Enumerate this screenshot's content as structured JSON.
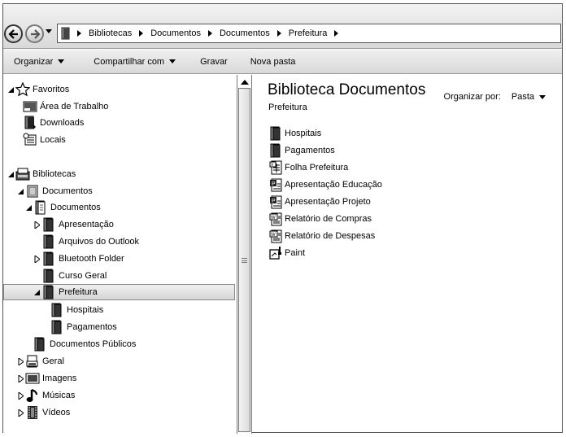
{
  "breadcrumb": [
    "Bibliotecas",
    "Documentos",
    "Documentos",
    "Prefeitura"
  ],
  "toolbar": {
    "organize": "Organizar",
    "share": "Compartilhar com",
    "burn": "Gravar",
    "new_folder": "Nova pasta"
  },
  "nav": {
    "favorites": "Favoritos",
    "desktop": "Área de Trabalho",
    "downloads": "Downloads",
    "places": "Locais",
    "libraries": "Bibliotecas",
    "documents_lib": "Documentos",
    "documents_folder": "Documentos",
    "presentation": "Apresentação",
    "outlook_files": "Arquivos do Outlook",
    "bluetooth": "Bluetooth Folder",
    "general_course": "Curso Geral",
    "city_hall": "Prefeitura",
    "hospitals": "Hospitais",
    "payments": "Pagamentos",
    "public_docs": "Documentos Públicos",
    "general": "Geral",
    "images": "Imagens",
    "music": "Músicas",
    "videos": "Vídeos"
  },
  "content": {
    "title": "Biblioteca Documentos",
    "subtitle": "Prefeitura",
    "arrange_label": "Organizar por:",
    "arrange_value": "Pasta",
    "items": [
      {
        "name": "Hospitais",
        "icon": "folder-icon"
      },
      {
        "name": "Pagamentos",
        "icon": "folder-icon"
      },
      {
        "name": "Folha Prefeitura",
        "icon": "spreadsheet-icon"
      },
      {
        "name": "Apresentação Educação",
        "icon": "presentation-icon"
      },
      {
        "name": "Apresentação Projeto",
        "icon": "presentation-icon"
      },
      {
        "name": "Relatório de Compras",
        "icon": "word-document-icon"
      },
      {
        "name": "Relatório de Despesas",
        "icon": "word-document-icon"
      },
      {
        "name": "Paint",
        "icon": "paint-icon"
      }
    ]
  }
}
